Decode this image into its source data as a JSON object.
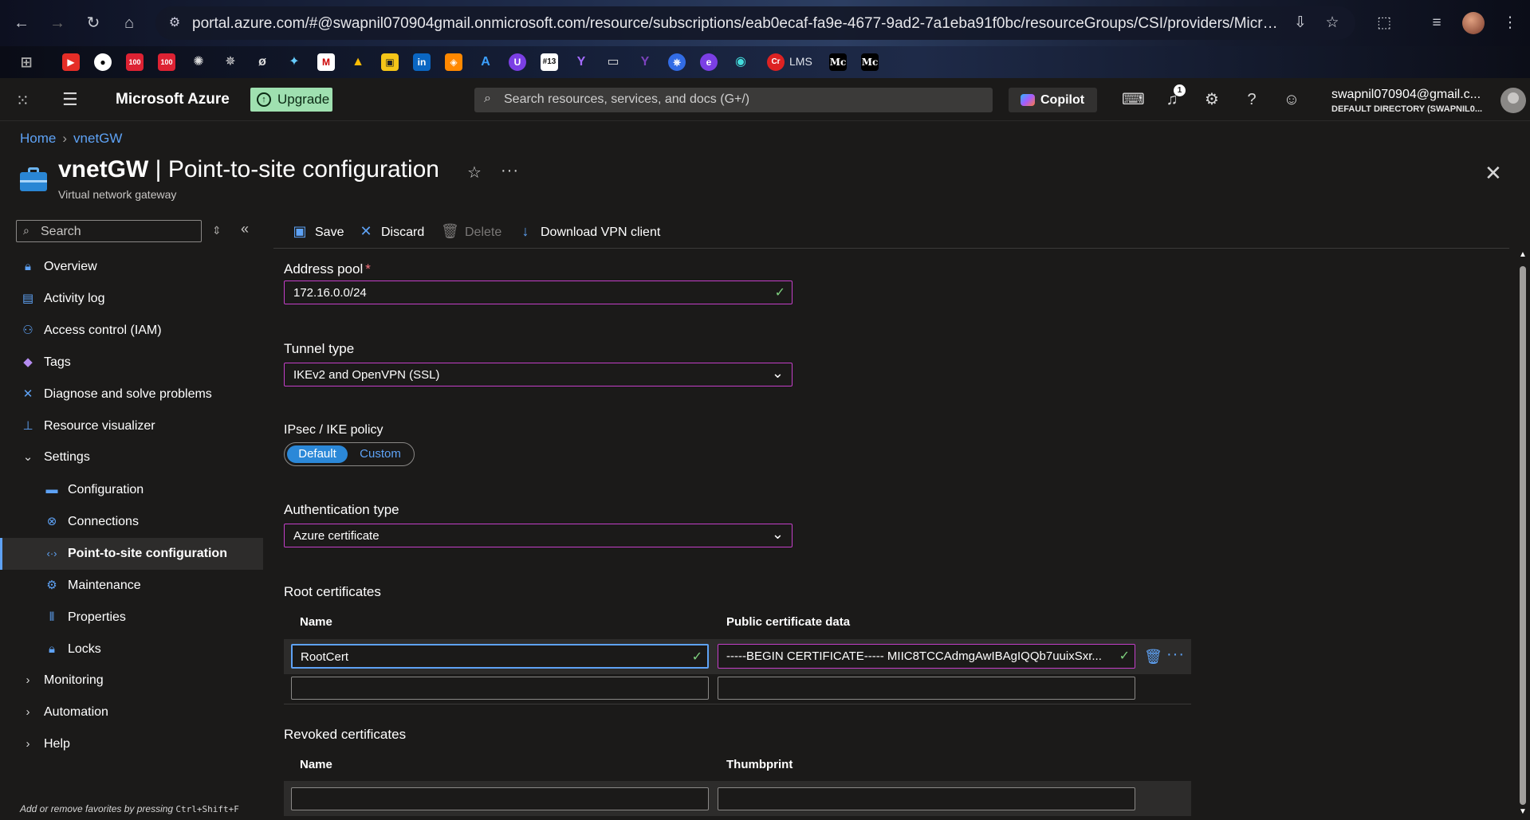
{
  "browser": {
    "url": "portal.azure.com/#@swapnil070904gmail.onmicrosoft.com/resource/subscriptions/eab0ecaf-fa9e-4677-9ad2-7a1eba91f0bc/resourceGroups/CSI/providers/Microsoft.Network...",
    "bookmark_lms": "LMS",
    "bookmark_mc1": "Mc",
    "bookmark_mc2": "Mc"
  },
  "portal": {
    "brand": "Microsoft Azure",
    "upgrade_label": "Upgrade",
    "search_placeholder": "Search resources, services, and docs (G+/)",
    "copilot_label": "Copilot",
    "notification_count": "1",
    "account_name": "swapnil070904@gmail.c...",
    "account_directory": "DEFAULT DIRECTORY (SWAPNIL0..."
  },
  "breadcrumb": {
    "home": "Home",
    "current": "vnetGW"
  },
  "page": {
    "title_resource": "vnetGW",
    "title_separator": " | ",
    "title_blade": "Point-to-site configuration",
    "subtitle": "Virtual network gateway"
  },
  "sidebar": {
    "search_placeholder": "Search",
    "items": [
      {
        "label": "Overview",
        "icon": "lock-icon"
      },
      {
        "label": "Activity log",
        "icon": "log-icon"
      },
      {
        "label": "Access control (IAM)",
        "icon": "people-icon"
      },
      {
        "label": "Tags",
        "icon": "tag-icon"
      },
      {
        "label": "Diagnose and solve problems",
        "icon": "wrench-icon"
      },
      {
        "label": "Resource visualizer",
        "icon": "hierarchy-icon"
      },
      {
        "label": "Settings",
        "icon": "chevron-down-icon"
      },
      {
        "label": "Configuration",
        "icon": "briefcase-icon"
      },
      {
        "label": "Connections",
        "icon": "connections-icon"
      },
      {
        "label": "Point-to-site configuration",
        "icon": "code-arrows-icon"
      },
      {
        "label": "Maintenance",
        "icon": "gear-icon"
      },
      {
        "label": "Properties",
        "icon": "properties-icon"
      },
      {
        "label": "Locks",
        "icon": "lock-icon"
      },
      {
        "label": "Monitoring",
        "icon": "chevron-right-icon"
      },
      {
        "label": "Automation",
        "icon": "chevron-right-icon"
      },
      {
        "label": "Help",
        "icon": "chevron-right-icon"
      }
    ],
    "footer_text": "Add or remove favorites by pressing ",
    "footer_shortcut": "Ctrl+Shift+F"
  },
  "toolbar": {
    "save": "Save",
    "discard": "Discard",
    "delete": "Delete",
    "download": "Download VPN client"
  },
  "form": {
    "address_pool_label": "Address pool",
    "address_pool_value": "172.16.0.0/24",
    "tunnel_type_label": "Tunnel type",
    "tunnel_type_value": "IKEv2 and OpenVPN (SSL)",
    "ipsec_label": "IPsec / IKE policy",
    "ipsec_options": [
      "Default",
      "Custom"
    ],
    "ipsec_selected": "Default",
    "auth_type_label": "Authentication type",
    "auth_type_value": "Azure certificate"
  },
  "root_certificates": {
    "title": "Root certificates",
    "col_name": "Name",
    "col_data": "Public certificate data",
    "rows": [
      {
        "name": "RootCert",
        "data": "-----BEGIN CERTIFICATE----- MIIC8TCCAdmgAwIBAgIQQb7uuixSxr..."
      },
      {
        "name": "",
        "data": ""
      }
    ]
  },
  "revoked_certificates": {
    "title": "Revoked certificates",
    "col_name": "Name",
    "col_thumb": "Thumbprint",
    "rows": [
      {
        "name": "",
        "thumbprint": ""
      }
    ]
  },
  "colors": {
    "accent": "#5ea2f5",
    "field_border": "#c43fc9",
    "valid_check": "#7ed07e",
    "upgrade_bg": "#9fe0b0"
  }
}
